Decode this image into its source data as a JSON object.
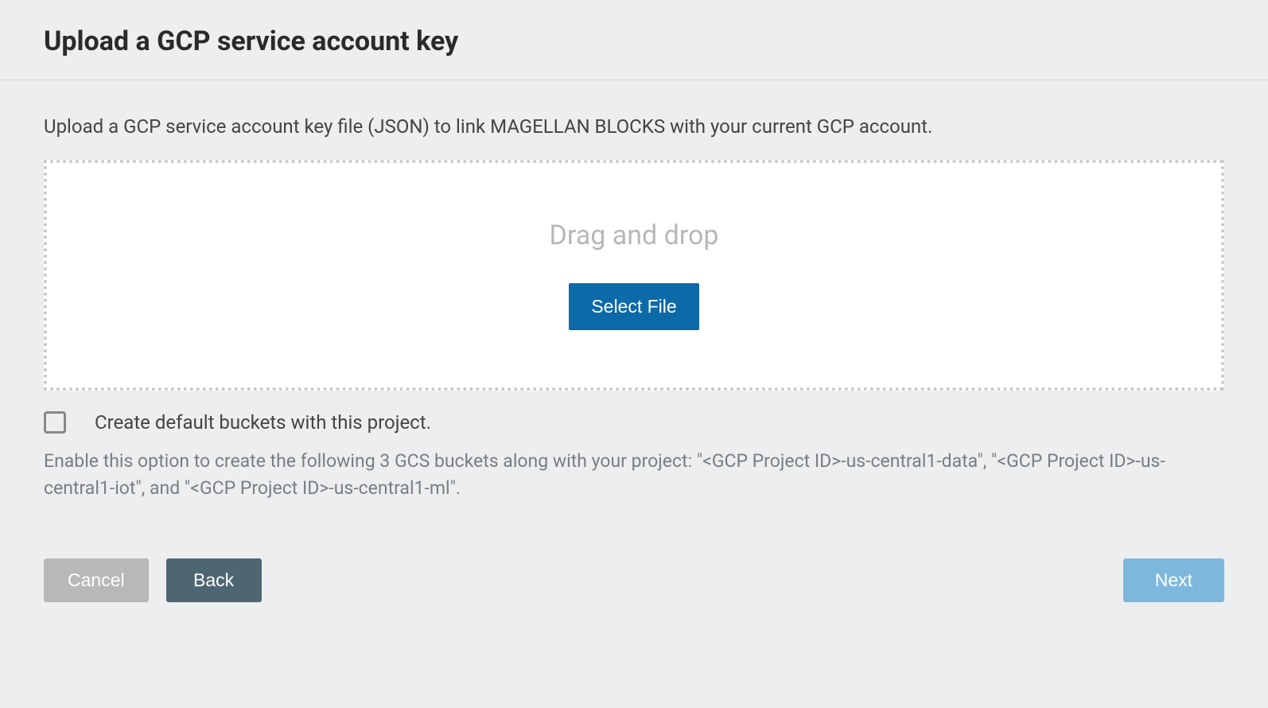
{
  "header": {
    "title": "Upload a GCP service account key"
  },
  "instruction": "Upload a GCP service account key file (JSON) to link MAGELLAN BLOCKS with your current GCP account.",
  "dropzone": {
    "text": "Drag and drop",
    "button_label": "Select File"
  },
  "checkbox": {
    "label": "Create default buckets with this project.",
    "checked": false
  },
  "help_text": "Enable this option to create the following 3 GCS buckets along with your project: \"<GCP Project ID>-us-central1-data\", \"<GCP Project ID>-us-central1-iot\", and \"<GCP Project ID>-us-central1-ml\".",
  "footer": {
    "cancel_label": "Cancel",
    "back_label": "Back",
    "next_label": "Next"
  },
  "colors": {
    "primary": "#0d6aa8",
    "cancel": "#b6b8ba",
    "back": "#4e6672",
    "next": "#7db8dc",
    "background": "#eceeef"
  }
}
